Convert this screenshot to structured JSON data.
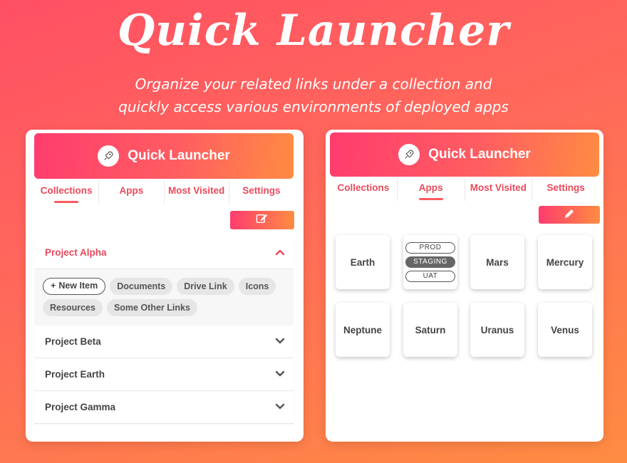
{
  "hero": {
    "title": "Quick Launcher",
    "subtitle_line1": "Organize your related links under a collection and",
    "subtitle_line2": "quickly access various environments of deployed apps"
  },
  "colors": {
    "accent": "#ff4f64",
    "accent2": "#ff8c42",
    "tab_text": "#e94a5a"
  },
  "left_panel": {
    "header_title": "Quick Launcher",
    "header_icon": "rocket-icon",
    "tabs": [
      "Collections",
      "Apps",
      "Most Visited",
      "Settings"
    ],
    "active_tab": "Collections",
    "edit_icon": "edit-note-icon",
    "collections": [
      {
        "name": "Project Alpha",
        "expanded": true,
        "new_item_label": "New Item",
        "links": [
          "Documents",
          "Drive Link",
          "Icons",
          "Resources",
          "Some Other Links"
        ]
      },
      {
        "name": "Project Beta",
        "expanded": false
      },
      {
        "name": "Project Earth",
        "expanded": false
      },
      {
        "name": "Project Gamma",
        "expanded": false
      }
    ]
  },
  "right_panel": {
    "header_title": "Quick Launcher",
    "header_icon": "rocket-icon",
    "tabs": [
      "Collections",
      "Apps",
      "Most Visited",
      "Settings"
    ],
    "active_tab": "Apps",
    "edit_icon": "pencil-icon",
    "apps": [
      "Earth",
      "",
      "Mars",
      "Mercury",
      "Neptune",
      "Saturn",
      "Uranus",
      "Venus"
    ],
    "environments": [
      "PROD",
      "STAGING",
      "UAT"
    ],
    "selected_environment": "STAGING"
  }
}
